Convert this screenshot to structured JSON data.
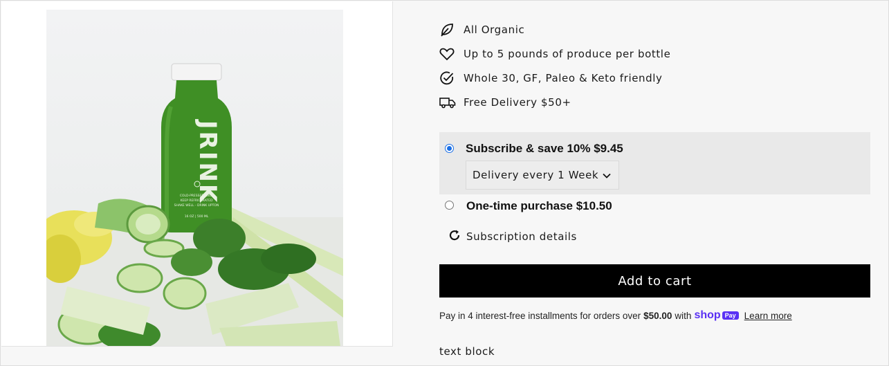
{
  "product_image": {
    "alt_label": "JRINK",
    "bottle_small_text": [
      "COLD-PRESSED JUICE",
      "KEEP REFRIGERATED",
      "SHAKE WELL - DRINK UPTON"
    ],
    "bottle_volume_text": "16 OZ | 500 ML"
  },
  "features": [
    {
      "icon": "leaf-icon",
      "label": "All Organic"
    },
    {
      "icon": "heart-icon",
      "label": "Up to 5 pounds of produce per bottle"
    },
    {
      "icon": "check-circle-icon",
      "label": "Whole 30, GF, Paleo & Keto friendly"
    },
    {
      "icon": "truck-icon",
      "label": "Free Delivery $50+"
    }
  ],
  "purchase_options": {
    "subscribe": {
      "label": "Subscribe & save 10% $9.45",
      "selected": true
    },
    "delivery_select": {
      "value": "Delivery every 1 Week"
    },
    "one_time": {
      "label": "One-time purchase $10.50",
      "selected": false
    },
    "details_label": "Subscription details"
  },
  "cart": {
    "button_label": "Add to cart"
  },
  "installments": {
    "prefix": "Pay in 4 interest-free installments for orders over",
    "amount": "$50.00",
    "with": "with",
    "shop_word": "shop",
    "pay_word": "Pay",
    "learn_more": "Learn more"
  },
  "text_block": "text block",
  "colors": {
    "accent_blue": "#1a6fe6",
    "shop_pay_purple": "#5a31f4",
    "button_black": "#000000",
    "option_bg": "#e9e9e9"
  }
}
